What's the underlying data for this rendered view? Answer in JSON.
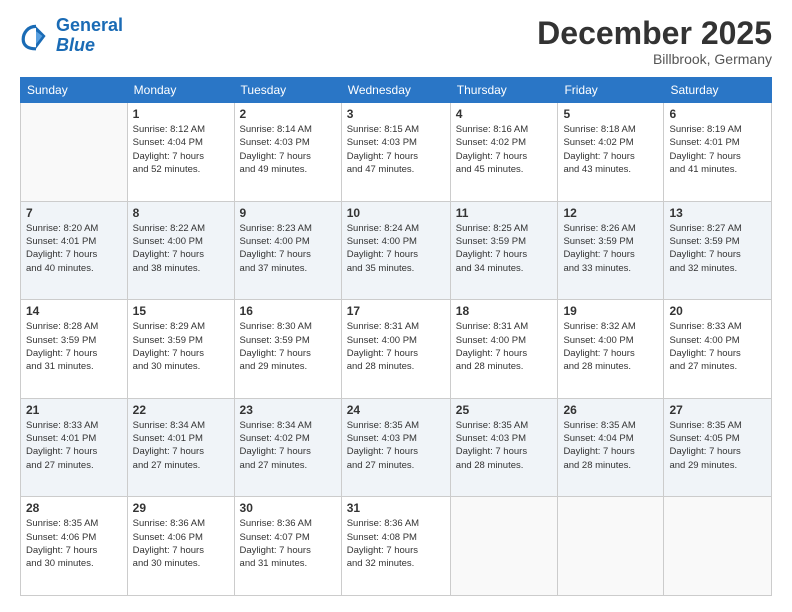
{
  "logo": {
    "line1": "General",
    "line2": "Blue"
  },
  "title": "December 2025",
  "location": "Billbrook, Germany",
  "header_days": [
    "Sunday",
    "Monday",
    "Tuesday",
    "Wednesday",
    "Thursday",
    "Friday",
    "Saturday"
  ],
  "weeks": [
    [
      {
        "day": "",
        "info": ""
      },
      {
        "day": "1",
        "info": "Sunrise: 8:12 AM\nSunset: 4:04 PM\nDaylight: 7 hours\nand 52 minutes."
      },
      {
        "day": "2",
        "info": "Sunrise: 8:14 AM\nSunset: 4:03 PM\nDaylight: 7 hours\nand 49 minutes."
      },
      {
        "day": "3",
        "info": "Sunrise: 8:15 AM\nSunset: 4:03 PM\nDaylight: 7 hours\nand 47 minutes."
      },
      {
        "day": "4",
        "info": "Sunrise: 8:16 AM\nSunset: 4:02 PM\nDaylight: 7 hours\nand 45 minutes."
      },
      {
        "day": "5",
        "info": "Sunrise: 8:18 AM\nSunset: 4:02 PM\nDaylight: 7 hours\nand 43 minutes."
      },
      {
        "day": "6",
        "info": "Sunrise: 8:19 AM\nSunset: 4:01 PM\nDaylight: 7 hours\nand 41 minutes."
      }
    ],
    [
      {
        "day": "7",
        "info": "Sunrise: 8:20 AM\nSunset: 4:01 PM\nDaylight: 7 hours\nand 40 minutes."
      },
      {
        "day": "8",
        "info": "Sunrise: 8:22 AM\nSunset: 4:00 PM\nDaylight: 7 hours\nand 38 minutes."
      },
      {
        "day": "9",
        "info": "Sunrise: 8:23 AM\nSunset: 4:00 PM\nDaylight: 7 hours\nand 37 minutes."
      },
      {
        "day": "10",
        "info": "Sunrise: 8:24 AM\nSunset: 4:00 PM\nDaylight: 7 hours\nand 35 minutes."
      },
      {
        "day": "11",
        "info": "Sunrise: 8:25 AM\nSunset: 3:59 PM\nDaylight: 7 hours\nand 34 minutes."
      },
      {
        "day": "12",
        "info": "Sunrise: 8:26 AM\nSunset: 3:59 PM\nDaylight: 7 hours\nand 33 minutes."
      },
      {
        "day": "13",
        "info": "Sunrise: 8:27 AM\nSunset: 3:59 PM\nDaylight: 7 hours\nand 32 minutes."
      }
    ],
    [
      {
        "day": "14",
        "info": "Sunrise: 8:28 AM\nSunset: 3:59 PM\nDaylight: 7 hours\nand 31 minutes."
      },
      {
        "day": "15",
        "info": "Sunrise: 8:29 AM\nSunset: 3:59 PM\nDaylight: 7 hours\nand 30 minutes."
      },
      {
        "day": "16",
        "info": "Sunrise: 8:30 AM\nSunset: 3:59 PM\nDaylight: 7 hours\nand 29 minutes."
      },
      {
        "day": "17",
        "info": "Sunrise: 8:31 AM\nSunset: 4:00 PM\nDaylight: 7 hours\nand 28 minutes."
      },
      {
        "day": "18",
        "info": "Sunrise: 8:31 AM\nSunset: 4:00 PM\nDaylight: 7 hours\nand 28 minutes."
      },
      {
        "day": "19",
        "info": "Sunrise: 8:32 AM\nSunset: 4:00 PM\nDaylight: 7 hours\nand 28 minutes."
      },
      {
        "day": "20",
        "info": "Sunrise: 8:33 AM\nSunset: 4:00 PM\nDaylight: 7 hours\nand 27 minutes."
      }
    ],
    [
      {
        "day": "21",
        "info": "Sunrise: 8:33 AM\nSunset: 4:01 PM\nDaylight: 7 hours\nand 27 minutes."
      },
      {
        "day": "22",
        "info": "Sunrise: 8:34 AM\nSunset: 4:01 PM\nDaylight: 7 hours\nand 27 minutes."
      },
      {
        "day": "23",
        "info": "Sunrise: 8:34 AM\nSunset: 4:02 PM\nDaylight: 7 hours\nand 27 minutes."
      },
      {
        "day": "24",
        "info": "Sunrise: 8:35 AM\nSunset: 4:03 PM\nDaylight: 7 hours\nand 27 minutes."
      },
      {
        "day": "25",
        "info": "Sunrise: 8:35 AM\nSunset: 4:03 PM\nDaylight: 7 hours\nand 28 minutes."
      },
      {
        "day": "26",
        "info": "Sunrise: 8:35 AM\nSunset: 4:04 PM\nDaylight: 7 hours\nand 28 minutes."
      },
      {
        "day": "27",
        "info": "Sunrise: 8:35 AM\nSunset: 4:05 PM\nDaylight: 7 hours\nand 29 minutes."
      }
    ],
    [
      {
        "day": "28",
        "info": "Sunrise: 8:35 AM\nSunset: 4:06 PM\nDaylight: 7 hours\nand 30 minutes."
      },
      {
        "day": "29",
        "info": "Sunrise: 8:36 AM\nSunset: 4:06 PM\nDaylight: 7 hours\nand 30 minutes."
      },
      {
        "day": "30",
        "info": "Sunrise: 8:36 AM\nSunset: 4:07 PM\nDaylight: 7 hours\nand 31 minutes."
      },
      {
        "day": "31",
        "info": "Sunrise: 8:36 AM\nSunset: 4:08 PM\nDaylight: 7 hours\nand 32 minutes."
      },
      {
        "day": "",
        "info": ""
      },
      {
        "day": "",
        "info": ""
      },
      {
        "day": "",
        "info": ""
      }
    ]
  ]
}
